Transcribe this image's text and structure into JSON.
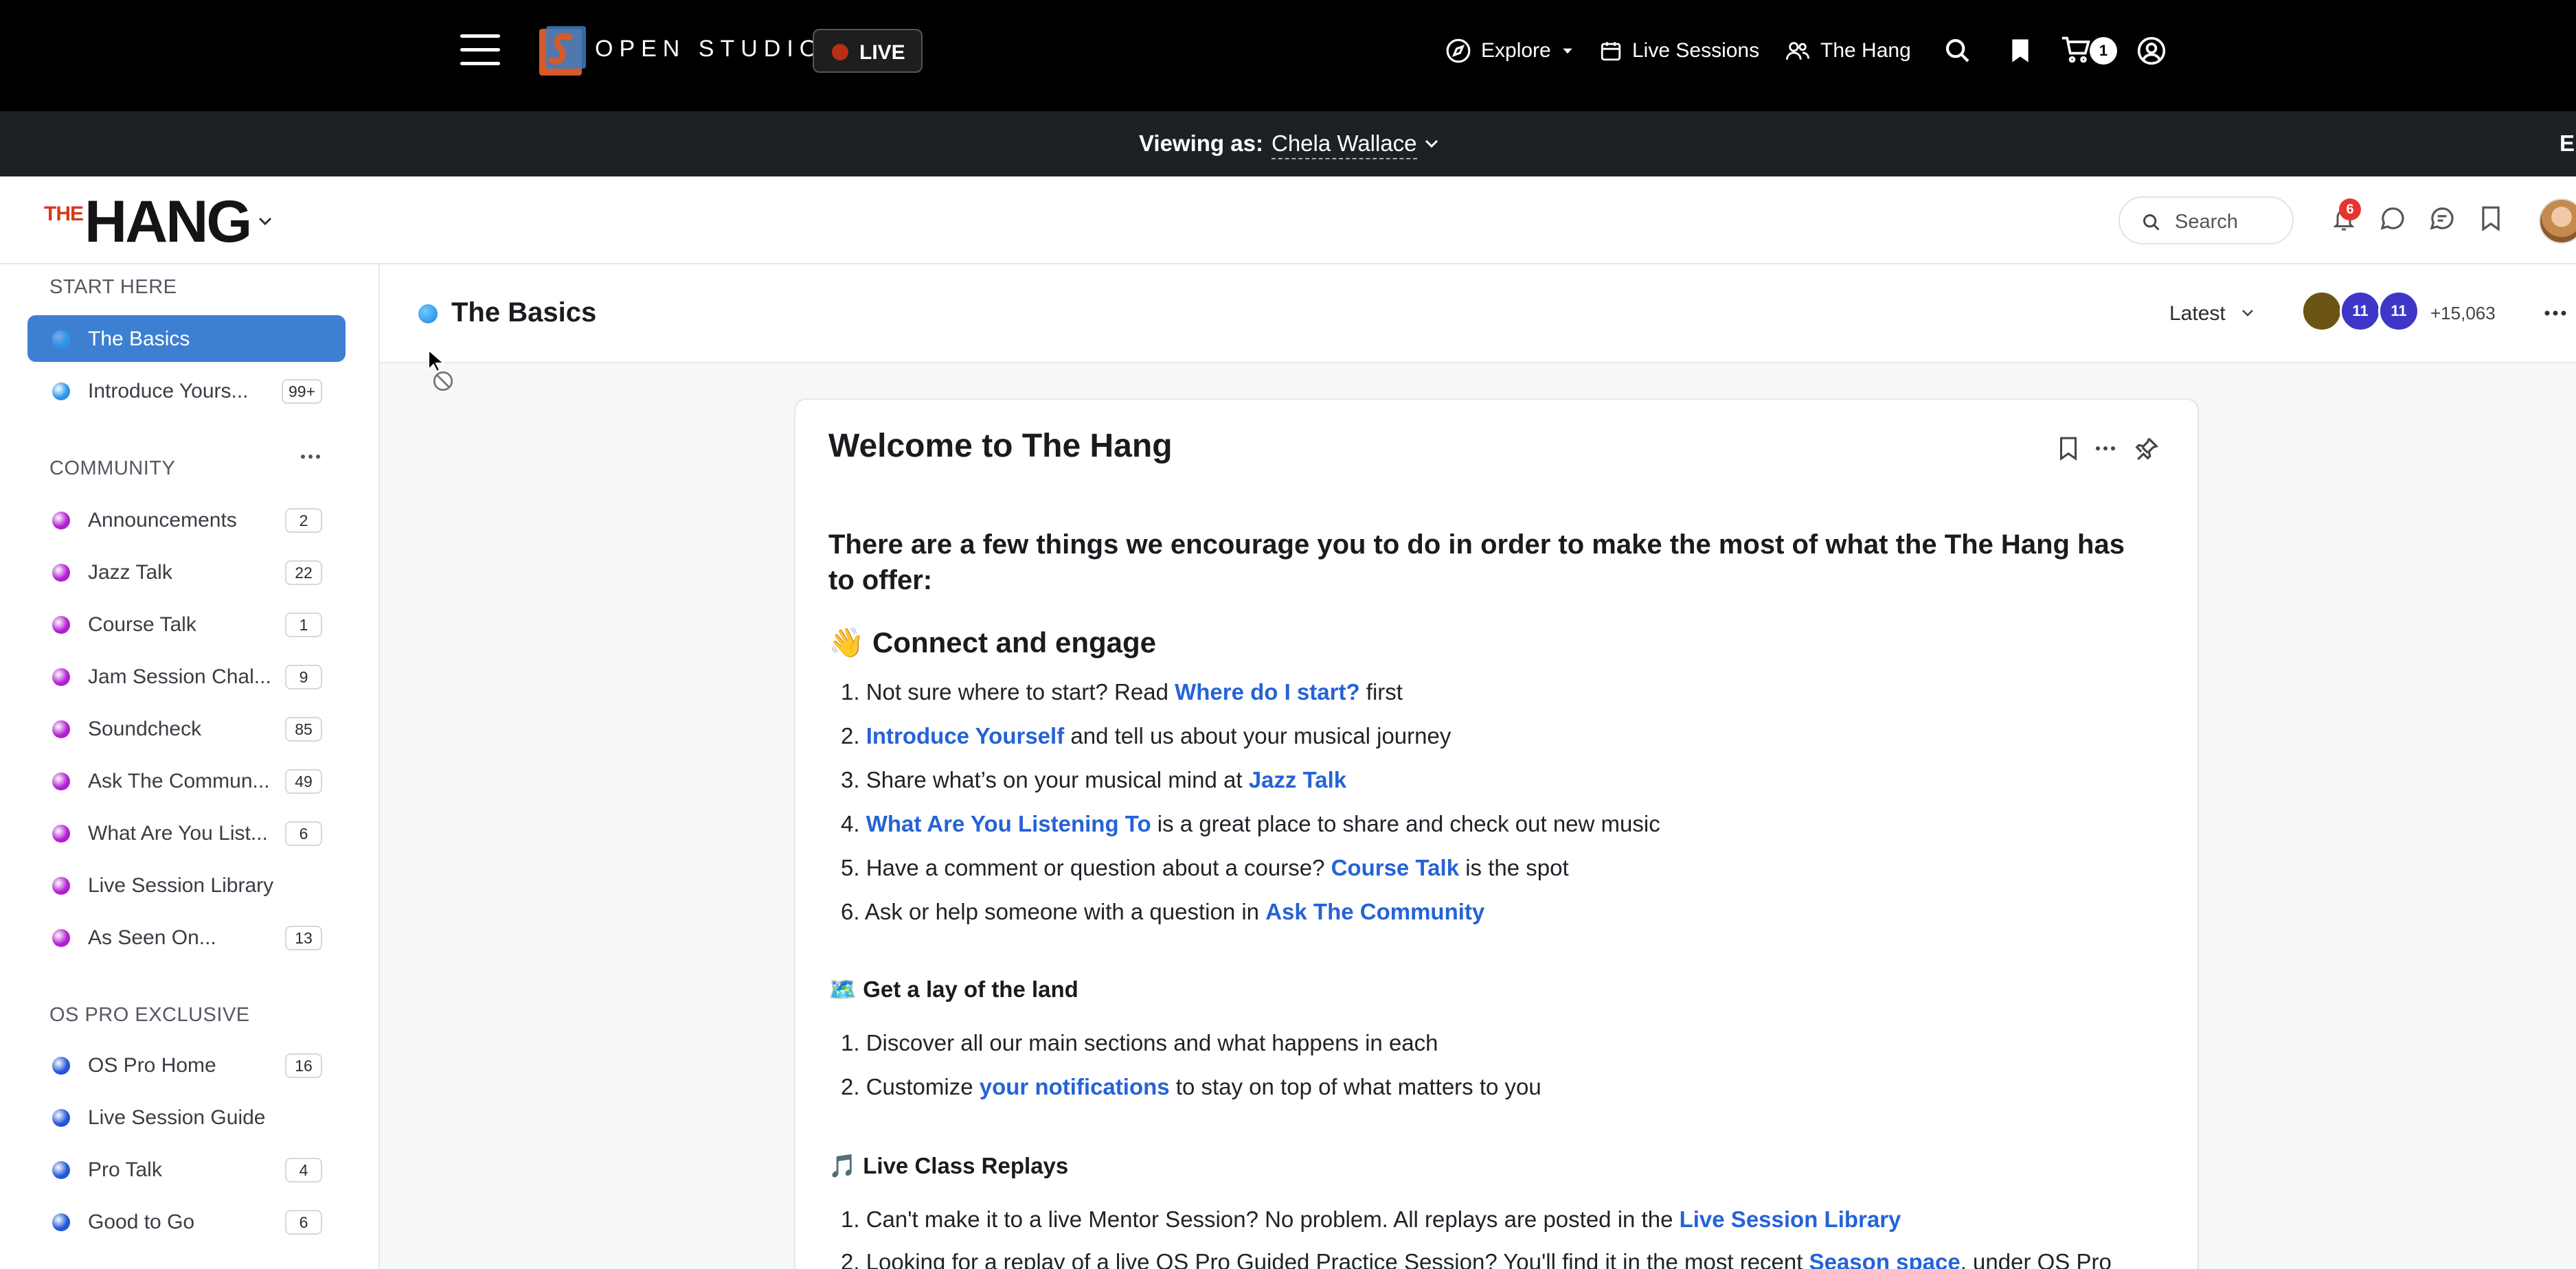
{
  "topbar": {
    "brand": "OPEN STUDIO",
    "live_label": "LIVE",
    "nav": {
      "explore": "Explore",
      "live_sessions": "Live Sessions",
      "the_hang": "The Hang"
    },
    "cart_count": "1",
    "icons": [
      "hamburger-icon",
      "compass-icon",
      "calendar-icon",
      "people-icon",
      "search-icon",
      "bookmark-icon",
      "cart-icon",
      "account-icon"
    ]
  },
  "viewing_bar": {
    "label": "Viewing as:",
    "user": "Chela Wallace",
    "exit_partial": "E"
  },
  "community": {
    "logo_the": "THE",
    "logo_hang": "HANG",
    "search_placeholder": "Search",
    "notification_count": "6"
  },
  "sidebar": {
    "sections": {
      "start_here": "START HERE",
      "community": "COMMUNITY",
      "os_pro": "OS PRO EXCLUSIVE"
    },
    "start_here": [
      {
        "label": "The Basics",
        "count": "",
        "color": "#2d95ea"
      },
      {
        "label": "Introduce Yours...",
        "count": "99+",
        "color": "#2d95ea"
      }
    ],
    "community": [
      {
        "label": "Announcements",
        "count": "2",
        "color": "#b21fd1"
      },
      {
        "label": "Jazz Talk",
        "count": "22",
        "color": "#b21fd1"
      },
      {
        "label": "Course Talk",
        "count": "1",
        "color": "#b21fd1"
      },
      {
        "label": "Jam Session Chal...",
        "count": "9",
        "color": "#b21fd1"
      },
      {
        "label": "Soundcheck",
        "count": "85",
        "color": "#b21fd1"
      },
      {
        "label": "Ask The Commun...",
        "count": "49",
        "color": "#b21fd1"
      },
      {
        "label": "What Are You List...",
        "count": "6",
        "color": "#b21fd1"
      },
      {
        "label": "Live Session Library",
        "count": "",
        "color": "#b21fd1"
      },
      {
        "label": "As Seen On...",
        "count": "13",
        "color": "#b21fd1"
      }
    ],
    "os_pro": [
      {
        "label": "OS Pro Home",
        "count": "16",
        "color": "#2456d9"
      },
      {
        "label": "Live Session Guide",
        "count": "",
        "color": "#2456d9"
      },
      {
        "label": "Pro Talk",
        "count": "4",
        "color": "#2456d9"
      },
      {
        "label": "Good to Go",
        "count": "6",
        "color": "#2456d9"
      }
    ]
  },
  "space": {
    "title": "The Basics",
    "sort": "Latest",
    "members": [
      {
        "label": "",
        "color": "#6b5414"
      },
      {
        "label": "11",
        "color": "#3f36c9"
      },
      {
        "label": "11",
        "color": "#3f36c9"
      }
    ],
    "member_extra": "+15,063"
  },
  "post": {
    "title": "Welcome to The Hang",
    "lead": "There are a few things we encourage you to do in order to make the most of what the The Hang has to offer:",
    "connect": {
      "heading": "👋 Connect and engage",
      "items": [
        {
          "num": "1.",
          "pre": "Not sure where to start? Read ",
          "link": "Where do I start?",
          "post": " first"
        },
        {
          "num": "2.",
          "pre": " ",
          "link": "Introduce Yourself",
          "post": " and tell us about your musical journey"
        },
        {
          "num": "3.",
          "pre": "Share what’s on your musical mind at ",
          "link": "Jazz Talk",
          "post": ""
        },
        {
          "num": "4.",
          "pre": "",
          "link": "What Are You Listening To",
          "post": " is a great place to share and check out new music"
        },
        {
          "num": "5.",
          "pre": "Have a comment or question about a course? ",
          "link": "Course Talk",
          "post": " is the spot"
        },
        {
          "num": "6.",
          "pre": "Ask or help someone with a question in ",
          "link": "Ask The Community",
          "post": ""
        }
      ]
    },
    "lay_of_land": {
      "heading": "🗺️ Get a lay of the land",
      "items": [
        {
          "num": "1.",
          "pre": "Discover all our main sections and what happens in each",
          "link": "",
          "post": ""
        },
        {
          "num": "2.",
          "pre": "Customize ",
          "link": "your notifications",
          "post": " to stay on top of what matters to you"
        }
      ]
    },
    "replays": {
      "heading": "🎵 Live Class Replays",
      "items": [
        {
          "num": "1.",
          "pre": "Can't make it to a live Mentor Session? No problem. All replays are posted in the ",
          "link": "Live Session Library",
          "post": ""
        },
        {
          "num": "2.",
          "pre": "Looking for a replay of a live OS Pro Guided Practice Session? You'll find it in the most recent ",
          "link": "Season space",
          "post": ", under OS Pro"
        }
      ]
    }
  }
}
